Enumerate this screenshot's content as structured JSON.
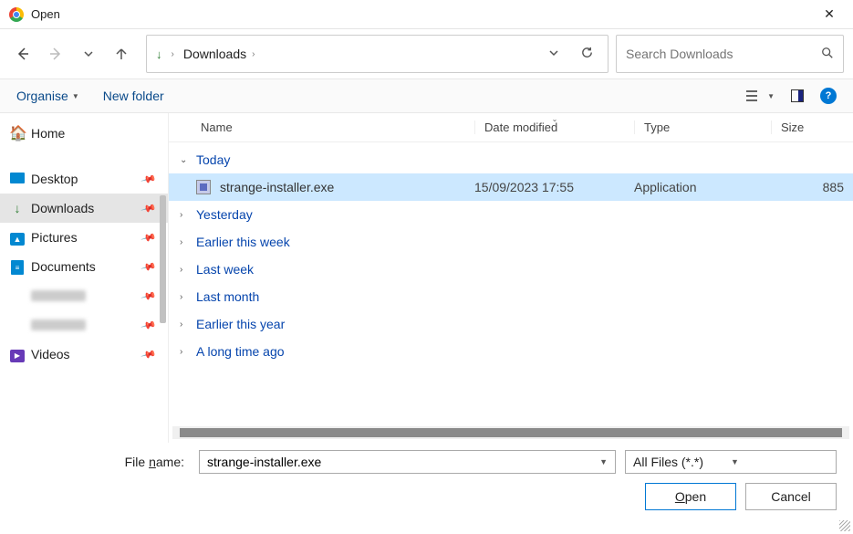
{
  "title": "Open",
  "nav": {
    "breadcrumb": "Downloads",
    "search_placeholder": "Search Downloads"
  },
  "toolbar": {
    "organise": "Organise",
    "new_folder": "New folder"
  },
  "sidebar": {
    "home": "Home",
    "desktop": "Desktop",
    "downloads": "Downloads",
    "pictures": "Pictures",
    "documents": "Documents",
    "videos": "Videos"
  },
  "columns": {
    "name": "Name",
    "date": "Date modified",
    "type": "Type",
    "size": "Size"
  },
  "groups": {
    "today": "Today",
    "yesterday": "Yesterday",
    "earlier_week": "Earlier this week",
    "last_week": "Last week",
    "last_month": "Last month",
    "earlier_year": "Earlier this year",
    "long_ago": "A long time ago"
  },
  "file": {
    "name": "strange-installer.exe",
    "date": "15/09/2023 17:55",
    "type": "Application",
    "size": "885"
  },
  "bottom": {
    "label_prefix": "File ",
    "label_ul": "n",
    "label_suffix": "ame:",
    "filename_value": "strange-installer.exe",
    "filter": "All Files (*.*)",
    "open_ul": "O",
    "open_suffix": "pen",
    "cancel": "Cancel"
  }
}
